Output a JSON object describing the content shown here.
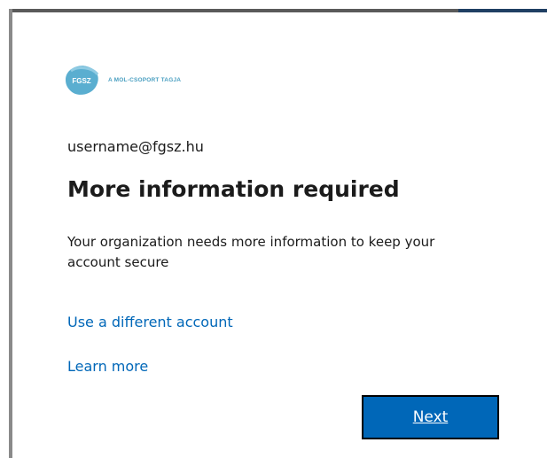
{
  "logo": {
    "brand_text": "FGSZ",
    "tagline": "A MOL-CSOPORT TAGJA"
  },
  "identity": {
    "username": "username@fgsz.hu"
  },
  "title": "More information required",
  "description": "Your organization needs more information to keep your account secure",
  "links": {
    "different_account": "Use a different account",
    "learn_more": "Learn more"
  },
  "buttons": {
    "next": "Next"
  },
  "colors": {
    "accent": "#0067b8",
    "logo": "#4a9fc1",
    "text": "#1b1b1b"
  }
}
